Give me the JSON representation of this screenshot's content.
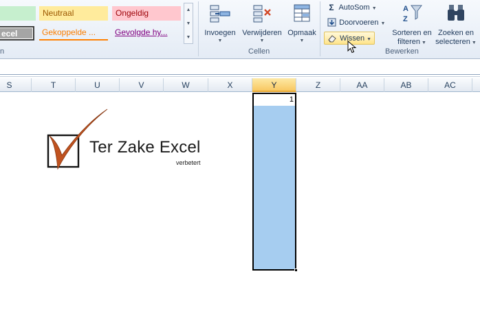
{
  "styles": {
    "goed": "",
    "neutraal": "Neutraal",
    "ongeldig": "Ongeldig",
    "controlecel": "ecel",
    "gekoppelde": "Gekoppelde ...",
    "gevolgde": "Gevolgde hy..."
  },
  "groups": {
    "stijlen_fragment": "n",
    "cellen": "Cellen",
    "bewerken": "Bewerken"
  },
  "cellen_buttons": {
    "invoegen": "Invoegen",
    "verwijderen": "Verwijderen",
    "opmaak": "Opmaak"
  },
  "bewerken_buttons": {
    "autosom": "AutoSom",
    "doorvoeren": "Doorvoeren",
    "wissen": "Wissen",
    "sorteren_line1": "Sorteren en",
    "sorteren_line2": "filteren",
    "zoeken_line1": "Zoeken en",
    "zoeken_line2": "selecteren"
  },
  "columns": [
    "S",
    "T",
    "U",
    "V",
    "W",
    "X",
    "Y",
    "Z",
    "AA",
    "AB",
    "AC"
  ],
  "selected_column": "Y",
  "active_cell_value": "1",
  "logo": {
    "title": "Ter Zake Excel",
    "tagline": "verbetert"
  },
  "colors": {
    "selection_fill": "#a6cdf0",
    "header_selected": "#f8c862",
    "ribbon_hot": "#ffe48b",
    "logo_check": "#c0521f"
  }
}
